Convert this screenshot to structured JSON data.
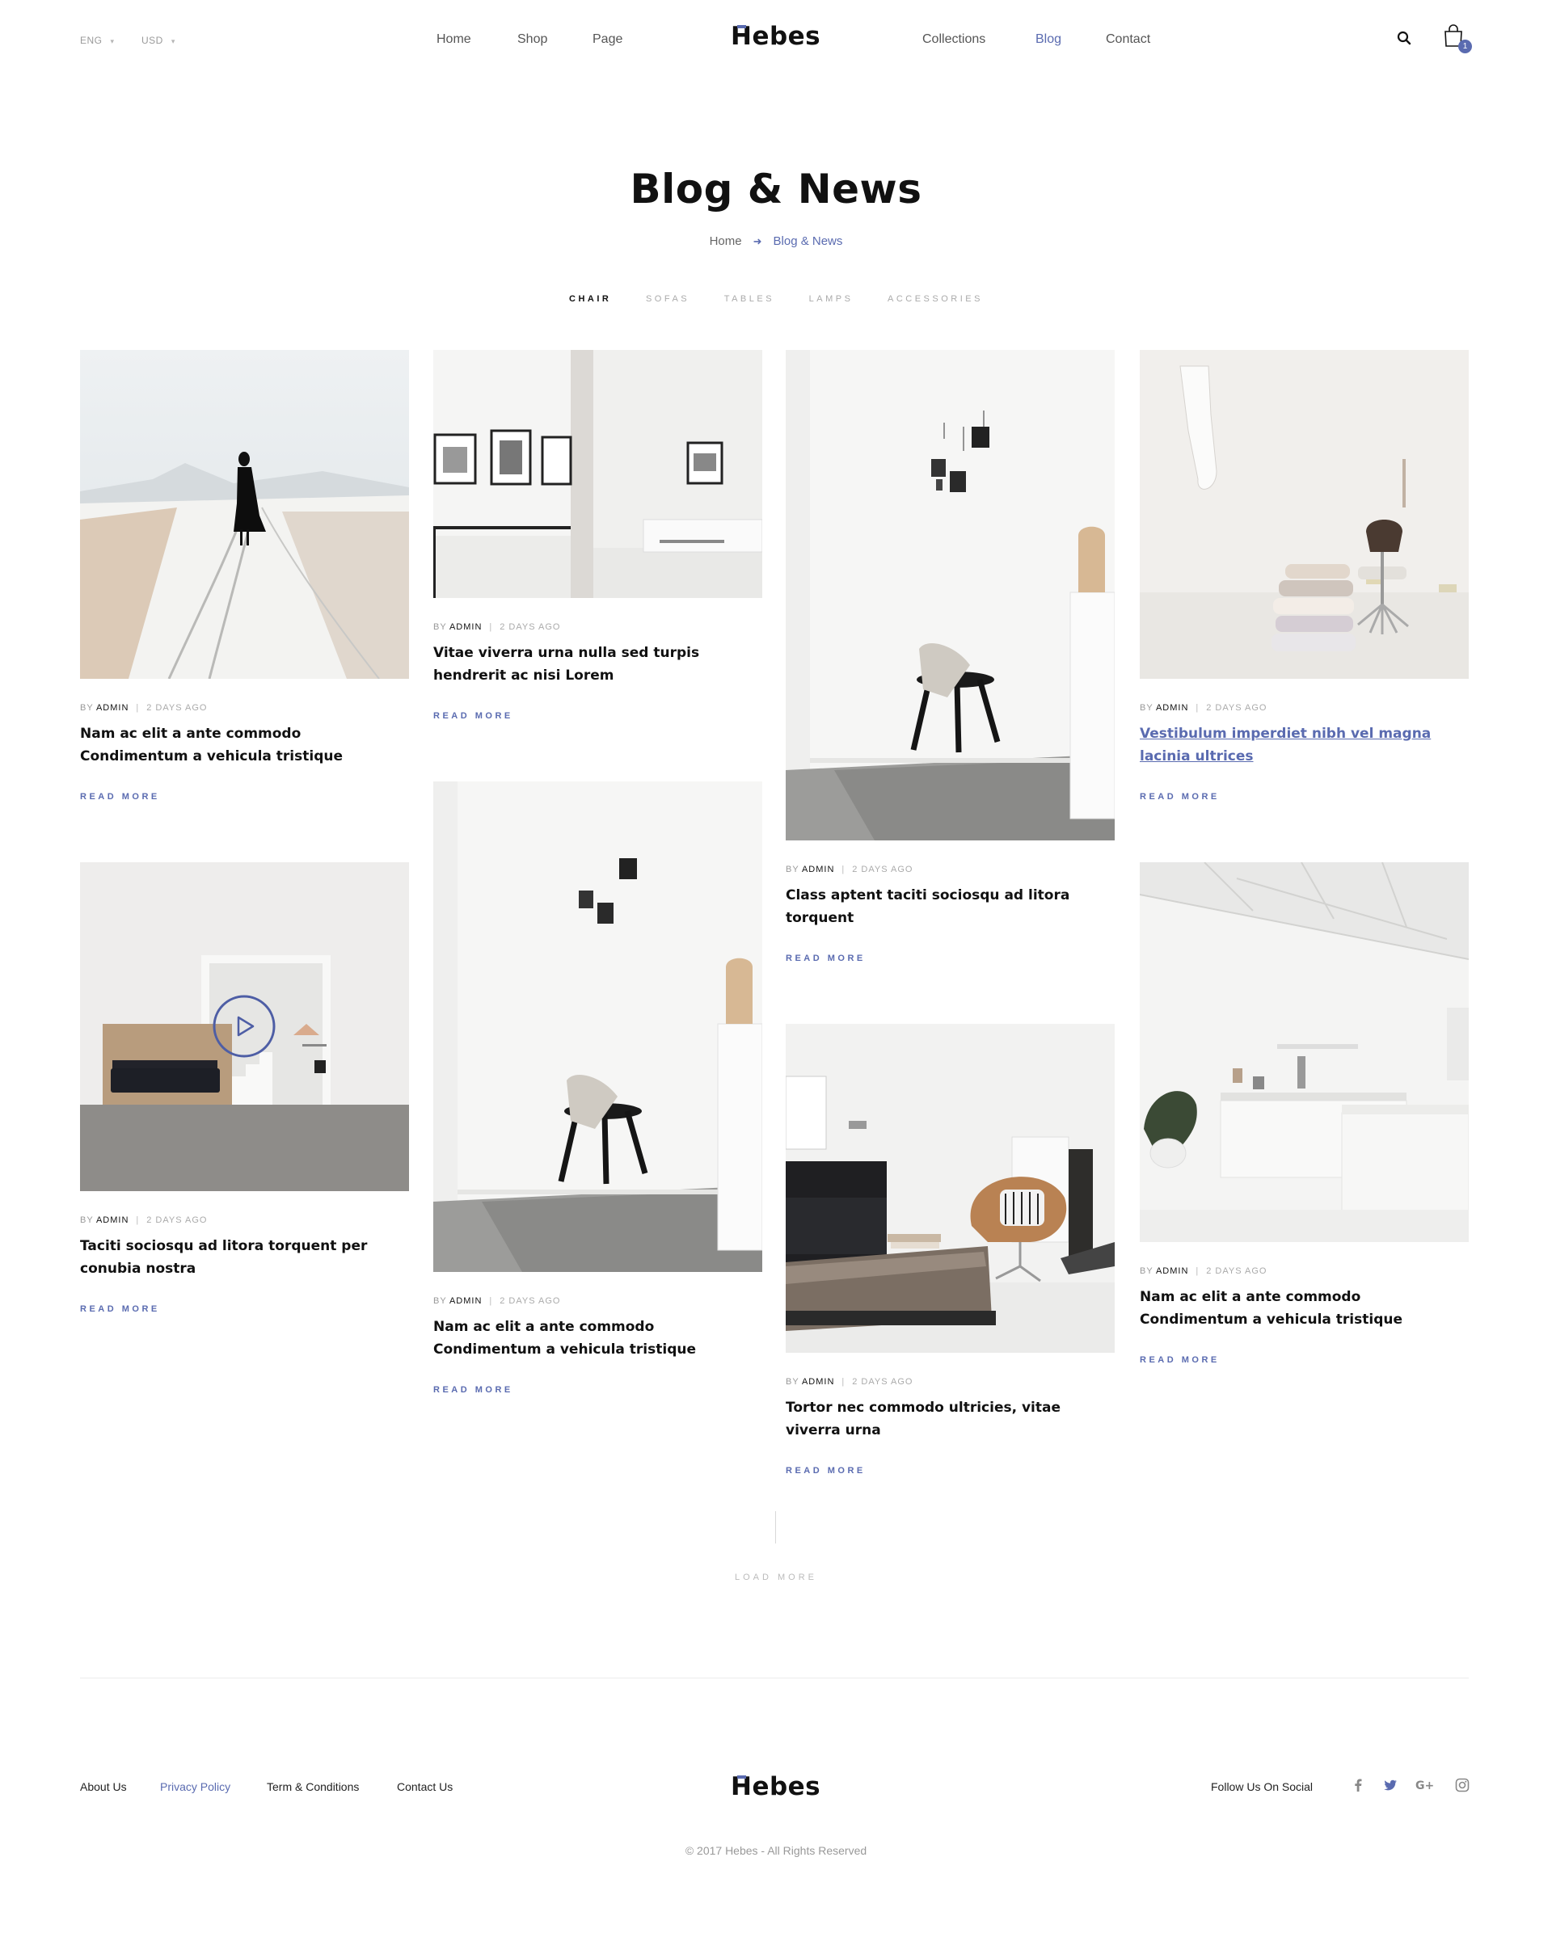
{
  "header": {
    "language": "ENG",
    "currency": "USD",
    "nav_left": [
      "Home",
      "Shop",
      "Page"
    ],
    "nav_right": [
      "Collections",
      "Blog",
      "Contact"
    ],
    "logo": "Hebes",
    "cart_count": "1",
    "accent_color": "#5a6bb0"
  },
  "page": {
    "title": "Blog & News",
    "breadcrumb_home": "Home",
    "breadcrumb_current": "Blog & News"
  },
  "tabs": [
    "CHAIR",
    "SOFAS",
    "TABLES",
    "LAMPS",
    "ACCESSORIES"
  ],
  "posts": [
    {
      "by": "BY",
      "author": "ADMIN",
      "date": "2 DAYS AGO",
      "title": "Nam ac elit a ante commodo Condimentum a vehicula tristique",
      "read_more": "READ MORE"
    },
    {
      "by": "BY",
      "author": "ADMIN",
      "date": "2 DAYS AGO",
      "title": "Vitae viverra urna nulla sed turpis hendrerit ac nisi Lorem",
      "read_more": "READ MORE"
    },
    {
      "by": "BY",
      "author": "ADMIN",
      "date": "2 DAYS AGO",
      "title": "Class aptent taciti sociosqu ad litora torquent",
      "read_more": "READ MORE"
    },
    {
      "by": "BY",
      "author": "ADMIN",
      "date": "2 DAYS AGO",
      "title": "Vestibulum imperdiet nibh vel magna lacinia ultrices",
      "read_more": "READ MORE"
    },
    {
      "by": "BY",
      "author": "ADMIN",
      "date": "2 DAYS AGO",
      "title": "Taciti sociosqu ad litora torquent per conubia nostra",
      "read_more": "READ MORE"
    },
    {
      "by": "BY",
      "author": "ADMIN",
      "date": "2 DAYS AGO",
      "title": "Nam ac elit a ante commodo Condimentum a vehicula tristique",
      "read_more": "READ MORE"
    },
    {
      "by": "BY",
      "author": "ADMIN",
      "date": "2 DAYS AGO",
      "title": "Tortor nec commodo ultricies, vitae viverra urna",
      "read_more": "READ MORE"
    },
    {
      "by": "BY",
      "author": "ADMIN",
      "date": "2 DAYS AGO",
      "title": "Nam ac elit a ante commodo Condimentum a vehicula tristique",
      "read_more": "READ MORE"
    }
  ],
  "load_more": "LOAD MORE",
  "footer": {
    "links": [
      "About Us",
      "Privacy Policy",
      "Term & Conditions",
      "Contact Us"
    ],
    "logo": "Hebes",
    "follow_label": "Follow Us On Social",
    "social_icons": [
      "facebook-icon",
      "twitter-icon",
      "google-plus-icon",
      "instagram-icon"
    ],
    "copyright": "© 2017 Hebes - All Rights Reserved"
  }
}
